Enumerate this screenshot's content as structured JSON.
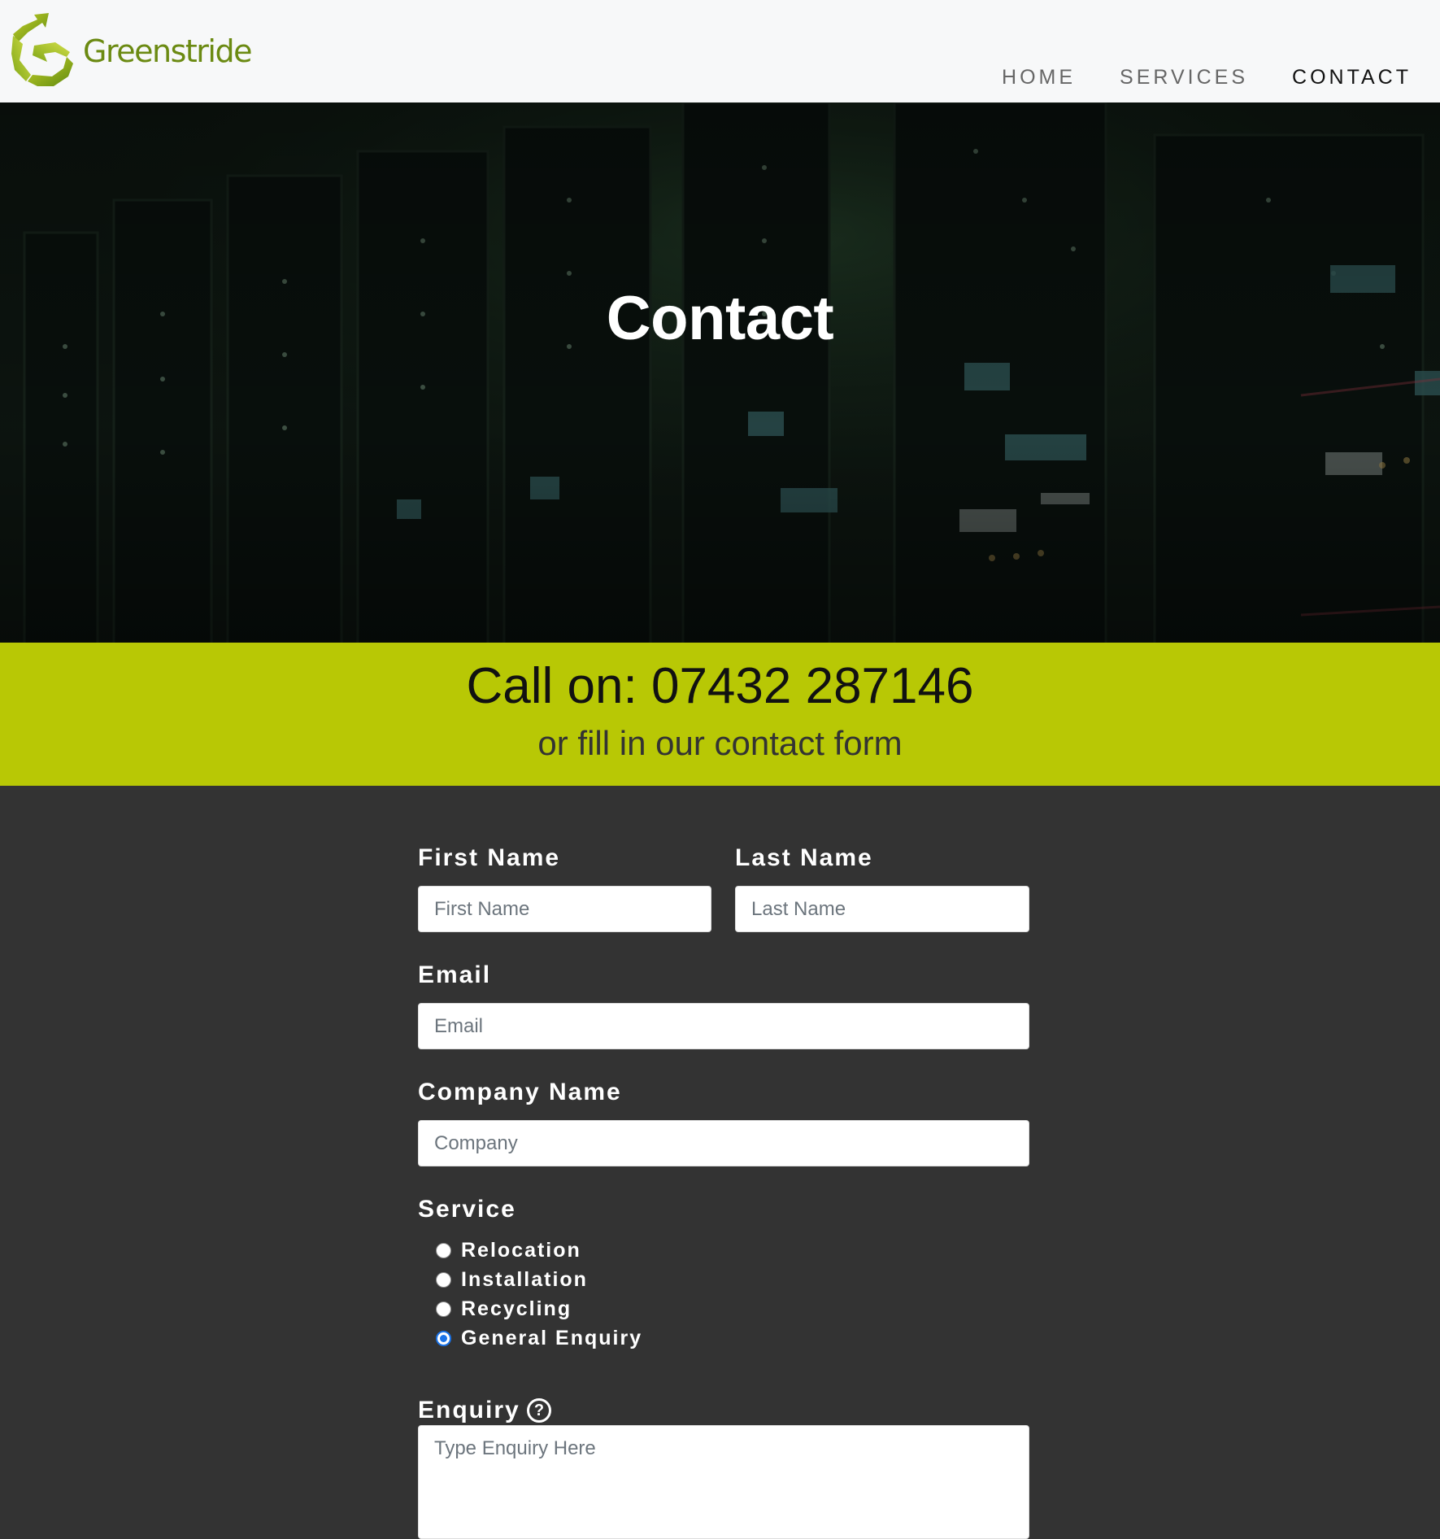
{
  "brand": {
    "name": "Greenstride",
    "logo_icon": "greenstride-arrows-logo",
    "accent": "#b8c805",
    "logo_text_color": "#6b8a12"
  },
  "nav": {
    "items": [
      {
        "label": "HOME",
        "active": false
      },
      {
        "label": "SERVICES",
        "active": false
      },
      {
        "label": "CONTACT",
        "active": true
      }
    ]
  },
  "hero": {
    "title": "Contact"
  },
  "callband": {
    "call_line": "Call on: 07432 287146",
    "sub_line": "or fill in our contact form"
  },
  "form": {
    "first_name": {
      "label": "First Name",
      "placeholder": "First Name",
      "value": ""
    },
    "last_name": {
      "label": "Last Name",
      "placeholder": "Last Name",
      "value": ""
    },
    "email": {
      "label": "Email",
      "placeholder": "Email",
      "value": ""
    },
    "company": {
      "label": "Company Name",
      "placeholder": "Company",
      "value": ""
    },
    "service": {
      "label": "Service",
      "options": [
        "Relocation",
        "Installation",
        "Recycling",
        "General Enquiry"
      ],
      "selected": "General Enquiry"
    },
    "enquiry": {
      "label": "Enquiry",
      "help_icon": "question-circle-icon",
      "placeholder": "Type Enquiry Here",
      "value": ""
    }
  },
  "colors": {
    "header_bg": "#f7f8f9",
    "form_bg": "#333333",
    "radio_selected": "#1a73e8"
  }
}
